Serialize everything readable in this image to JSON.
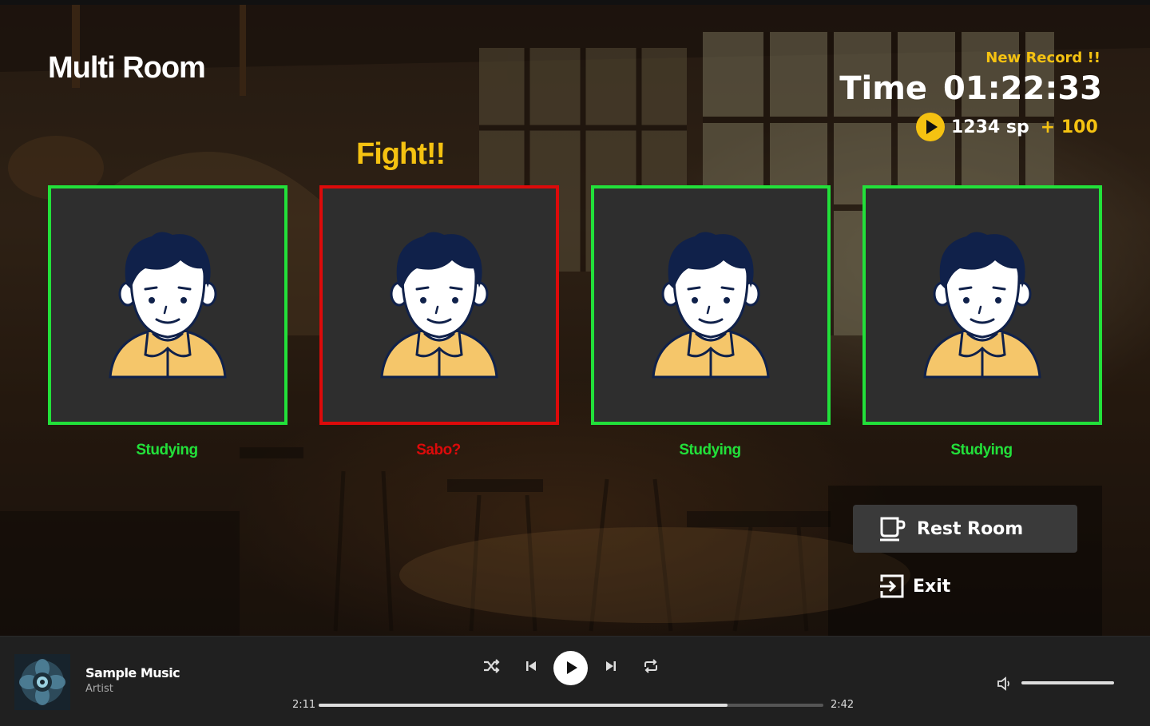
{
  "room": {
    "title": "Multi Room"
  },
  "stats": {
    "record_label": "New Record !!",
    "time_label": "Time",
    "time_value": "01:22:33",
    "points": "1234 sp",
    "bonus": "+ 100"
  },
  "alert_text": "Fight!!",
  "members": [
    {
      "status": "Studying",
      "state": "ok",
      "color": "#22e03a"
    },
    {
      "status": "Sabo?",
      "state": "alert",
      "color": "#dd0a0a"
    },
    {
      "status": "Studying",
      "state": "ok",
      "color": "#22e03a"
    },
    {
      "status": "Studying",
      "state": "ok",
      "color": "#22e03a"
    }
  ],
  "actions": {
    "rest_room": "Rest Room",
    "exit": "Exit"
  },
  "player": {
    "track_title": "Sample Music",
    "artist": "Artist",
    "current_time": "2:11",
    "total_time": "2:42",
    "progress": 0.81,
    "volume": 1.0,
    "icons": [
      "shuffle-icon",
      "previous-icon",
      "play-icon",
      "next-icon",
      "repeat-icon",
      "volume-icon"
    ]
  },
  "colors": {
    "accent": "#f5c211",
    "active": "#22e03a",
    "alert": "#dd0a0a"
  }
}
